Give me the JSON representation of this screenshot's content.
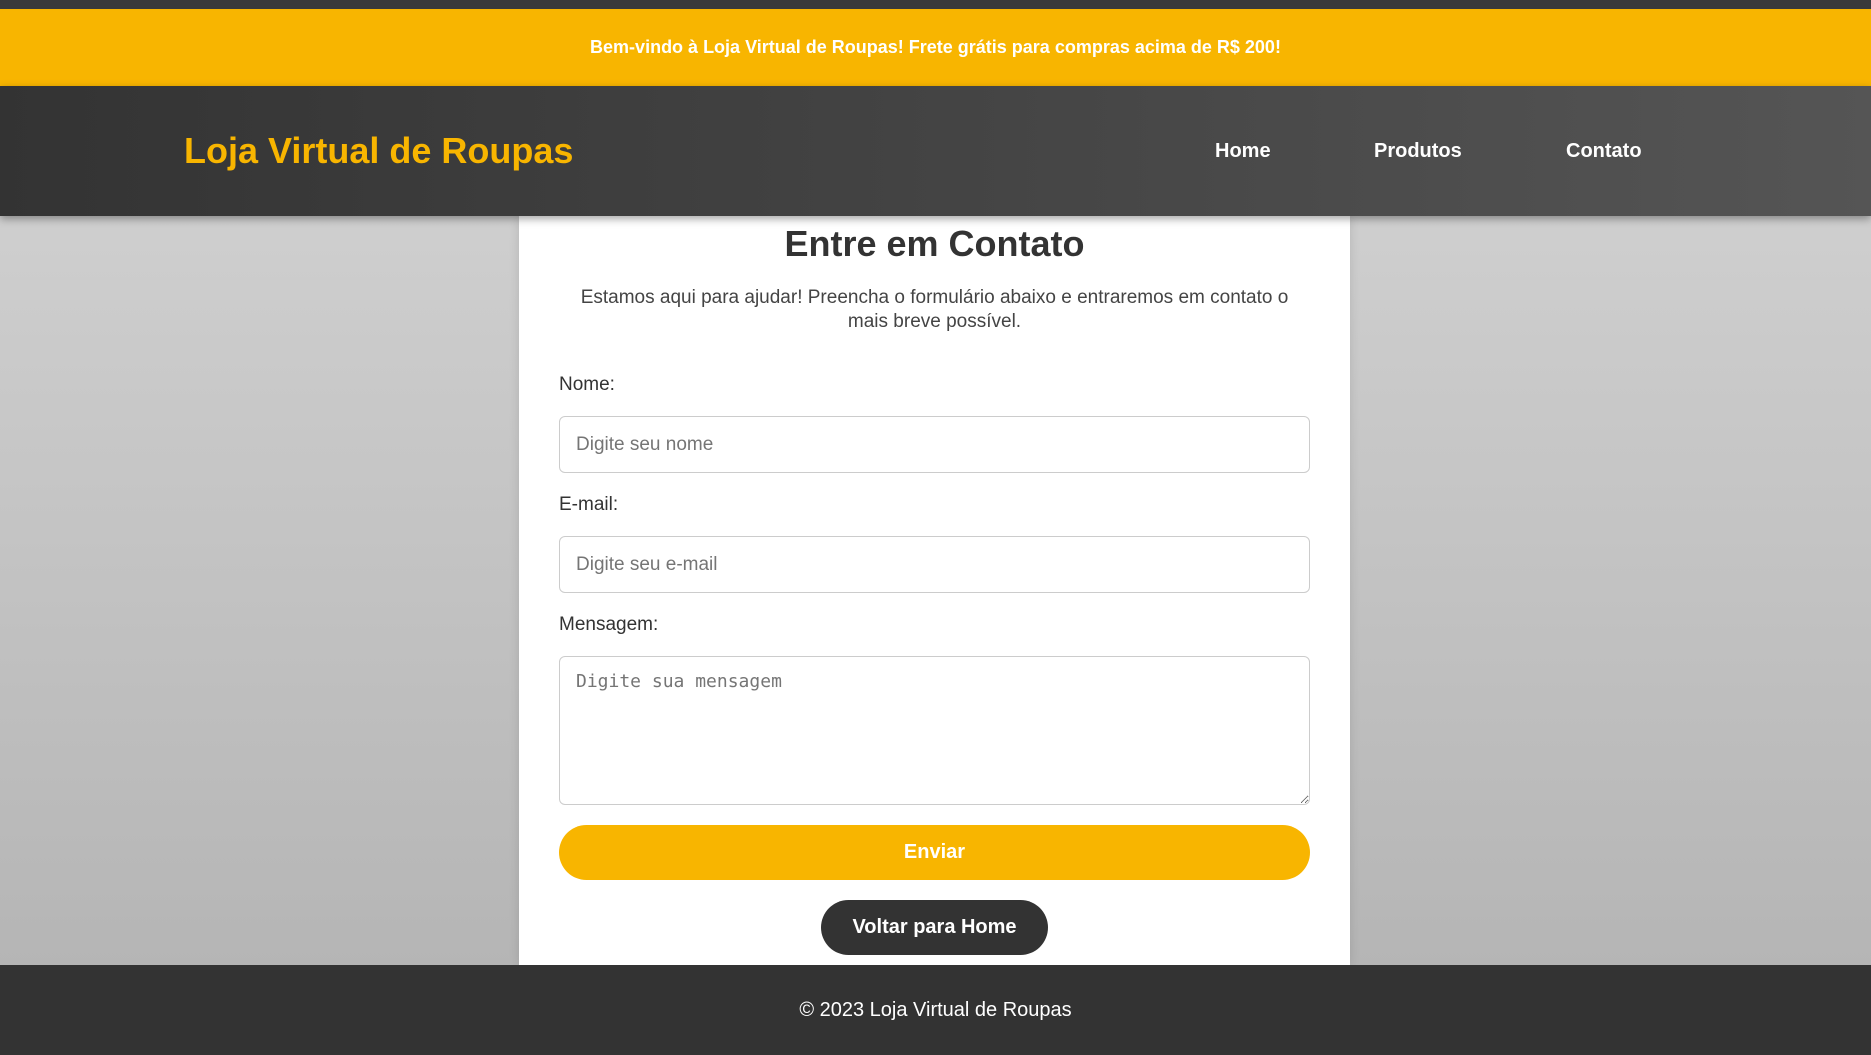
{
  "promo": {
    "text": "Bem-vindo à Loja Virtual de Roupas! Frete grátis para compras acima de R$ 200!"
  },
  "header": {
    "logo": "Loja Virtual de Roupas",
    "nav": [
      {
        "label": "Home"
      },
      {
        "label": "Produtos"
      },
      {
        "label": "Contato"
      }
    ]
  },
  "contact": {
    "title": "Entre em Contato",
    "intro": "Estamos aqui para ajudar! Preencha o formulário abaixo e entraremos em contato o mais breve possível.",
    "name_label": "Nome:",
    "name_placeholder": "Digite seu nome",
    "email_label": "E-mail:",
    "email_placeholder": "Digite seu e-mail",
    "message_label": "Mensagem:",
    "message_placeholder": "Digite sua mensagem",
    "submit_label": "Enviar",
    "back_label": "Voltar para Home"
  },
  "footer": {
    "text": "© 2023 Loja Virtual de Roupas"
  },
  "colors": {
    "accent": "#f8b500",
    "dark": "#333333"
  }
}
